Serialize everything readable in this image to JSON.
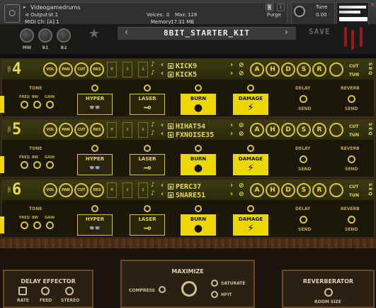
{
  "host": {
    "instrument": "Videogamedrums",
    "output": "st.1",
    "voices_label": "Voices:",
    "voices": "0",
    "max_label": "Max:",
    "max": "128",
    "purge": "Purge",
    "midi": "MIDI Ch: [A] 1",
    "memory_label": "Memory:",
    "memory": "17.31 MB",
    "tune_label": "Tune",
    "tune_value": "0.00",
    "close": "✕"
  },
  "header": {
    "knobs": [
      "MW",
      "B1",
      "B2"
    ],
    "kit_name": "8BIT_STARTER_KIT",
    "save_label": "SAVE"
  },
  "tracks": [
    {
      "number": "4",
      "samples": [
        "KICK9",
        "KICK5"
      ],
      "top_knobs": [
        "VOL",
        "PAN",
        "CUT",
        "RES"
      ],
      "env": [
        "A",
        "H",
        "D",
        "S",
        "R"
      ],
      "cut_label": "CUT",
      "tun_label": "TUN",
      "seq_label": "SEQ",
      "tone_label": "TONE",
      "freq_bw_gain": [
        "FREQ",
        "BW",
        "GAIN"
      ],
      "fx": [
        {
          "label": "HYPER",
          "icon": "👓",
          "on": false
        },
        {
          "label": "LASER",
          "icon": "⊸",
          "on": false
        },
        {
          "label": "BURN",
          "icon": "●",
          "on": true
        },
        {
          "label": "DAMAGE",
          "icon": "⚡",
          "on": true
        }
      ],
      "delay_label": "DELAY",
      "reverb_label": "REVERB",
      "send_label": "SEND"
    },
    {
      "number": "5",
      "samples": [
        "HIHAT54",
        "FXNOISE35"
      ],
      "top_knobs": [
        "VOL",
        "PAN",
        "CUT",
        "RES"
      ],
      "env": [
        "A",
        "H",
        "D",
        "S",
        "R"
      ],
      "cut_label": "CUT",
      "tun_label": "TUN",
      "seq_label": "SEQ",
      "tone_label": "TONE",
      "freq_bw_gain": [
        "FREQ",
        "BW",
        "GAIN"
      ],
      "fx": [
        {
          "label": "HYPER",
          "icon": "👓",
          "on": false
        },
        {
          "label": "LASER",
          "icon": "⊸",
          "on": false
        },
        {
          "label": "BURN",
          "icon": "●",
          "on": true
        },
        {
          "label": "DAMAGE",
          "icon": "⚡",
          "on": true
        }
      ],
      "delay_label": "DELAY",
      "reverb_label": "REVERB",
      "send_label": "SEND"
    },
    {
      "number": "6",
      "samples": [
        "PERC37",
        "SNARE51"
      ],
      "top_knobs": [
        "VOL",
        "PAN",
        "CUT",
        "RES"
      ],
      "env": [
        "A",
        "H",
        "D",
        "S",
        "R"
      ],
      "cut_label": "CUT",
      "tun_label": "TUN",
      "seq_label": "SEQ",
      "tone_label": "TONE",
      "freq_bw_gain": [
        "FREQ",
        "BW",
        "GAIN"
      ],
      "fx": [
        {
          "label": "HYPER",
          "icon": "👓",
          "on": false
        },
        {
          "label": "LASER",
          "icon": "⊸",
          "on": false
        },
        {
          "label": "BURN",
          "icon": "●",
          "on": true
        },
        {
          "label": "DAMAGE",
          "icon": "⚡",
          "on": true
        }
      ],
      "delay_label": "DELAY",
      "reverb_label": "REVERB",
      "send_label": "SEND"
    }
  ],
  "bottom": {
    "delay": {
      "title": "DELAY EFFECTOR",
      "labels": [
        "RATE",
        "FEED",
        "STEREO"
      ]
    },
    "maximize": {
      "title": "MAXIMIZE",
      "compress": "COMPRESS",
      "saturate": "SATURATE",
      "hfit": "HFIT"
    },
    "reverb": {
      "title": "REVERBERATOR",
      "room": "ROOM SIZE"
    }
  },
  "colors": {
    "accent": "#ecd800",
    "panel": "#2a2112",
    "wood": "#6b4524"
  }
}
